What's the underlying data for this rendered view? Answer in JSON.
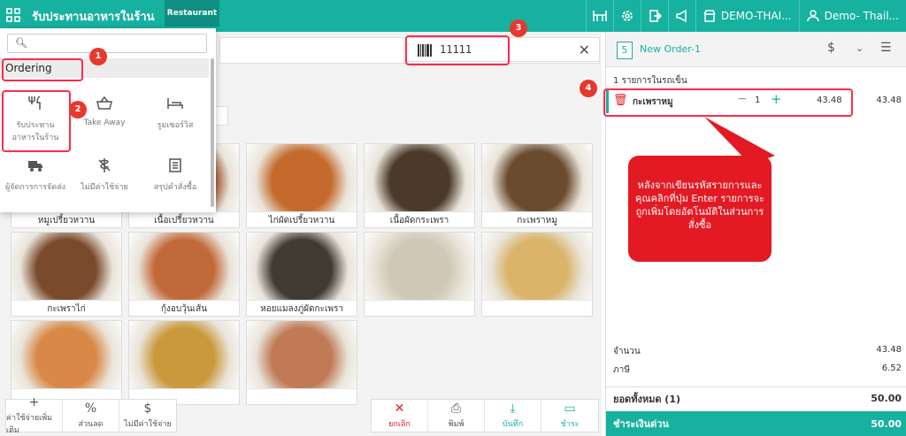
{
  "header": {
    "app_title": "รับประทานอาหารในร้าน",
    "mode_badge": "Restaurant",
    "branch": "DEMO-THAI...",
    "user": "Demo- Thail..."
  },
  "search": {
    "barcode_value": "11111"
  },
  "menu": {
    "section": "Ordering",
    "options": [
      {
        "label": "รับประทาน\nอาหารในร้าน",
        "icon": "fork-knife-icon"
      },
      {
        "label": "Take Away",
        "icon": "basket-icon"
      },
      {
        "label": "รูมเซอร์วิส",
        "icon": "bed-icon"
      },
      {
        "label": "ผู้จัดการการจัดส่ง",
        "icon": "truck-icon"
      },
      {
        "label": "ไม่มีค่าใช้จ่าย",
        "icon": "no-charge-icon"
      },
      {
        "label": "สรุปคำสั่งซื้อ",
        "icon": "list-icon"
      }
    ]
  },
  "products": [
    {
      "label": "หมูเปรี้ยวหวาน",
      "color": "#b4532a"
    },
    {
      "label": "เนื้อเปรี้ยวหวาน",
      "color": "#9a4b26"
    },
    {
      "label": "ไก่ผัดเปรี้ยวหวาน",
      "color": "#c46a2c"
    },
    {
      "label": "เนื้อผัดกระเพรา",
      "color": "#4b3a2a"
    },
    {
      "label": "กะเพราหมู",
      "color": "#6b4b2e"
    },
    {
      "label": "กะเพราไก่",
      "color": "#7a4a2c"
    },
    {
      "label": "กุ้งอบวุ้นเส้น",
      "color": "#c2693a"
    },
    {
      "label": "หอยแมลงภู่ผัดกะเพรา",
      "color": "#3f3b33"
    },
    {
      "label": "",
      "color": "#cfc8b6"
    },
    {
      "label": "",
      "color": "#d9b46a"
    },
    {
      "label": "",
      "color": "#d88948"
    },
    {
      "label": "",
      "color": "#c9993b"
    },
    {
      "label": "",
      "color": "#c07a55"
    }
  ],
  "bottom_toolbar": {
    "left": [
      {
        "label": "ค่าใช้จ่ายเพิ่มเติม",
        "icon": "+"
      },
      {
        "label": "ส่วนลด",
        "icon": "%"
      },
      {
        "label": "ไม่มีค่าใช้จ่าย",
        "icon": "$"
      }
    ],
    "right": [
      {
        "label": "ยกเลิก",
        "icon": "✕",
        "color": "#e0202a"
      },
      {
        "label": "พิมพ์",
        "icon": "⎙",
        "color": "#555555"
      },
      {
        "label": "บันทึก",
        "icon": "⤓",
        "color": "#17b1a0"
      },
      {
        "label": "ชำระ",
        "icon": "▭",
        "color": "#17b1a0"
      }
    ]
  },
  "order": {
    "number": "5",
    "name": "New Order-1",
    "item_count": "1 รายการในรถเข็น",
    "item": {
      "name": "กะเพราหมู",
      "qty": "1",
      "price": "43.48",
      "total": "43.48"
    },
    "subtotal_label": "จำนวน",
    "subtotal": "43.48",
    "tax_label": "ภาษี",
    "tax": "6.52",
    "grand_label": "ยอดทั้งหมด (1)",
    "grand_total": "50.00",
    "pay_label": "ชำระเงินด่วน",
    "pay_total": "50.00"
  },
  "annotations": {
    "markers": [
      "1",
      "2",
      "3",
      "4"
    ],
    "callout": "หลังจากเขียนรหัสรายการและคุณคลิกที่ปุ่ม Enter รายการจะถูกเพิ่มโดยอัตโนมัติในส่วนการสั่งซื้อ"
  },
  "colors": {
    "accent": "#17b1a0",
    "danger": "#e31a23"
  }
}
